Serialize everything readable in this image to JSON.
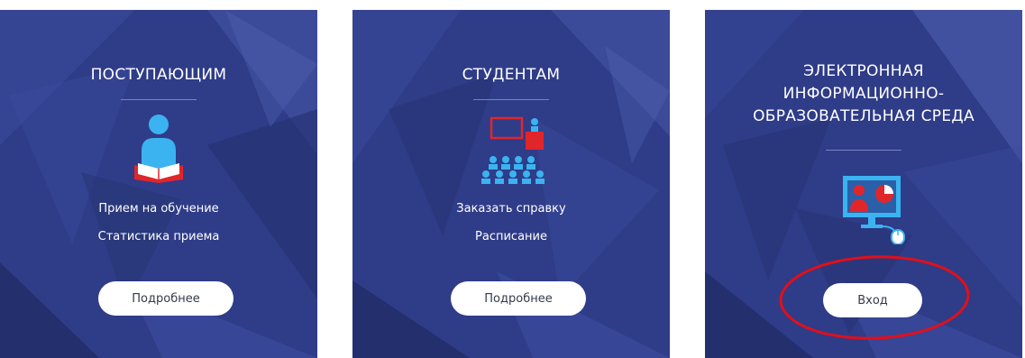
{
  "colors": {
    "card_background": "#2e3b86",
    "button_background": "#ffffff",
    "icon_blue": "#3bb3f0",
    "icon_red": "#e0262b",
    "highlight_oval": "#e0101a"
  },
  "cards": [
    {
      "title_lines": [
        "ПОСТУПАЮЩИМ"
      ],
      "icon": "reading-person-icon",
      "links": [
        "Прием на обучение",
        "Статистика приема"
      ],
      "button": "Подробнее"
    },
    {
      "title_lines": [
        "СТУДЕНТАМ"
      ],
      "icon": "lecture-audience-icon",
      "links": [
        "Заказать справку",
        "Расписание"
      ],
      "button": "Подробнее"
    },
    {
      "title_lines": [
        "ЭЛЕКТРОННАЯ",
        "ИНФОРМАЦИОННО-",
        "ОБРАЗОВАТЕЛЬНАЯ СРЕДА"
      ],
      "icon": "computer-presentation-icon",
      "links": [],
      "button": "Вход",
      "highlighted": true
    }
  ]
}
